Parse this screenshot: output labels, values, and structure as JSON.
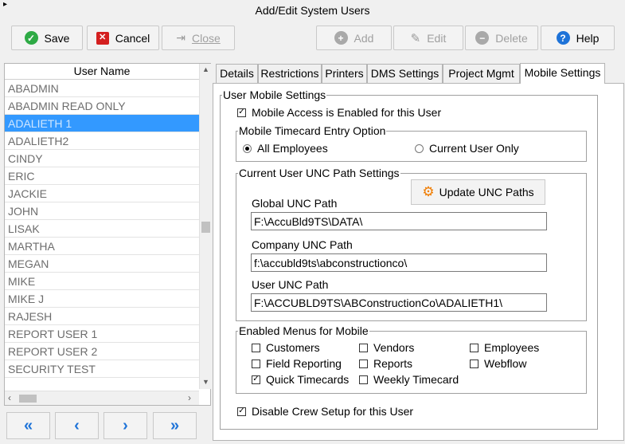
{
  "window": {
    "title": "Add/Edit System Users"
  },
  "toolbar": {
    "save_label": "Save",
    "cancel_label": "Cancel",
    "close_label": "Close",
    "add_label": "Add",
    "edit_label": "Edit",
    "delete_label": "Delete",
    "help_label": "Help"
  },
  "user_list": {
    "header": "User Name",
    "selected": "ADALIETH 1",
    "users": [
      "ABADMIN",
      "ABADMIN READ ONLY",
      "ADALIETH 1",
      "ADALIETH2",
      "CINDY",
      "ERIC",
      "JACKIE",
      "JOHN",
      "LISAK",
      "MARTHA",
      "MEGAN",
      "MIKE",
      "MIKE J",
      "RAJESH",
      "REPORT USER 1",
      "REPORT USER 2",
      "SECURITY TEST"
    ]
  },
  "nav": {
    "first": "«",
    "prev": "‹",
    "next": "›",
    "last": "»"
  },
  "tabs": {
    "details": "Details",
    "restrictions": "Restrictions",
    "printers": "Printers",
    "dms": "DMS Settings",
    "project": "Project Mgmt",
    "mobile": "Mobile Settings",
    "active": "Mobile Settings"
  },
  "mobile": {
    "group_title": "User Mobile Settings",
    "access_label": "Mobile Access is Enabled for this User",
    "access_checked": true,
    "timecard_title": "Mobile Timecard Entry Option",
    "opt_all": "All Employees",
    "opt_current": "Current User Only",
    "timecard_selected": "All Employees",
    "unc_title": "Current User UNC Path Settings",
    "update_label": "Update UNC Paths",
    "global_label": "Global UNC Path",
    "global_value": "F:\\AccuBld9TS\\DATA\\",
    "company_label": "Company UNC Path",
    "company_value": "f:\\accubld9ts\\abconstructionco\\",
    "user_label": "User UNC Path",
    "user_value": "F:\\ACCUBLD9TS\\ABConstructionCo\\ADALIETH1\\",
    "menus_title": "Enabled Menus for Mobile",
    "menus": {
      "customers": {
        "label": "Customers",
        "checked": false
      },
      "vendors": {
        "label": "Vendors",
        "checked": false
      },
      "employees": {
        "label": "Employees",
        "checked": false
      },
      "field_reporting": {
        "label": "Field Reporting",
        "checked": false
      },
      "reports": {
        "label": "Reports",
        "checked": false
      },
      "webflow": {
        "label": "Webflow",
        "checked": false
      },
      "quick_timecards": {
        "label": "Quick Timecards",
        "checked": true
      },
      "weekly_timecard": {
        "label": "Weekly Timecard",
        "checked": false
      }
    },
    "crew_label": "Disable Crew Setup for this User",
    "crew_checked": true
  },
  "colors": {
    "selection": "#3399ff",
    "save_icon": "#2eaa45",
    "cancel_icon": "#d42020",
    "help_icon": "#1e73d8",
    "nav_arrows": "#1e73d8",
    "gear_icon": "#f07c00"
  },
  "icons": {
    "save": "check-circle-icon",
    "cancel": "x-square-icon",
    "close": "exit-arrow-icon",
    "add": "plus-circle-icon",
    "edit": "pencil-page-icon",
    "delete": "minus-circle-icon",
    "help": "question-circle-icon",
    "update": "gears-icon"
  }
}
